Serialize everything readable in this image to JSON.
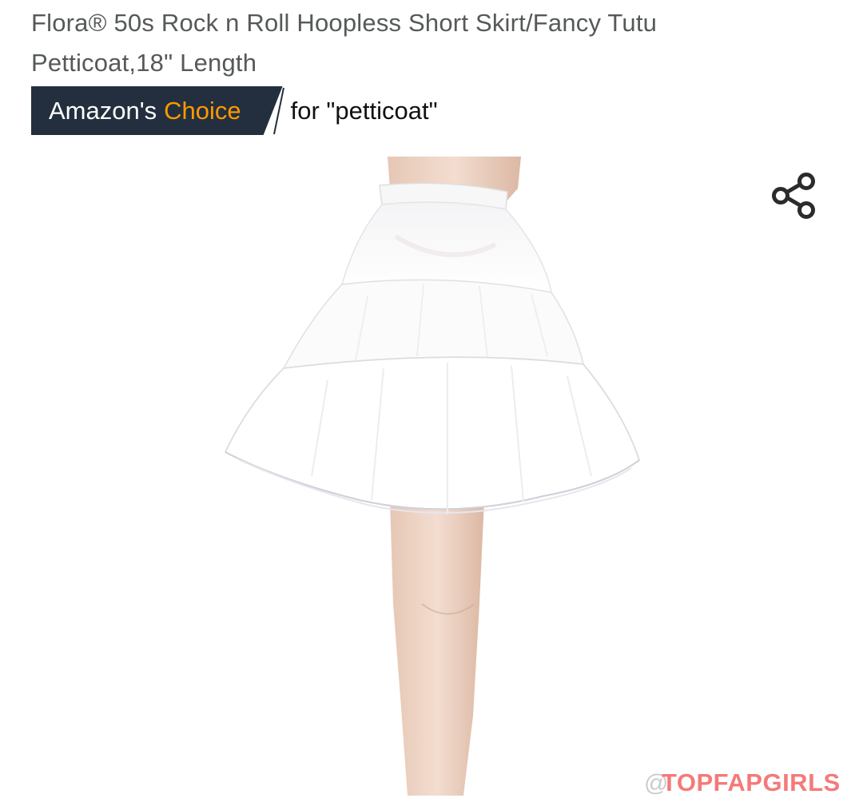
{
  "product": {
    "title": "Flora® 50s Rock n Roll Hoopless Short Skirt/Fancy Tutu Petticoat,18\" Length",
    "image_alt": "White petticoat tutu skirt on mannequin"
  },
  "badge": {
    "prefix": "Amazon's",
    "highlight": "Choice",
    "query": "for \"petticoat\"",
    "colors": {
      "background": "#232f3e",
      "highlight": "#ff9900"
    }
  },
  "share": {
    "icon": "share-icon",
    "label": "Share"
  },
  "watermark": {
    "handle": "@",
    "brand": "TOPFAPGIRLS"
  }
}
